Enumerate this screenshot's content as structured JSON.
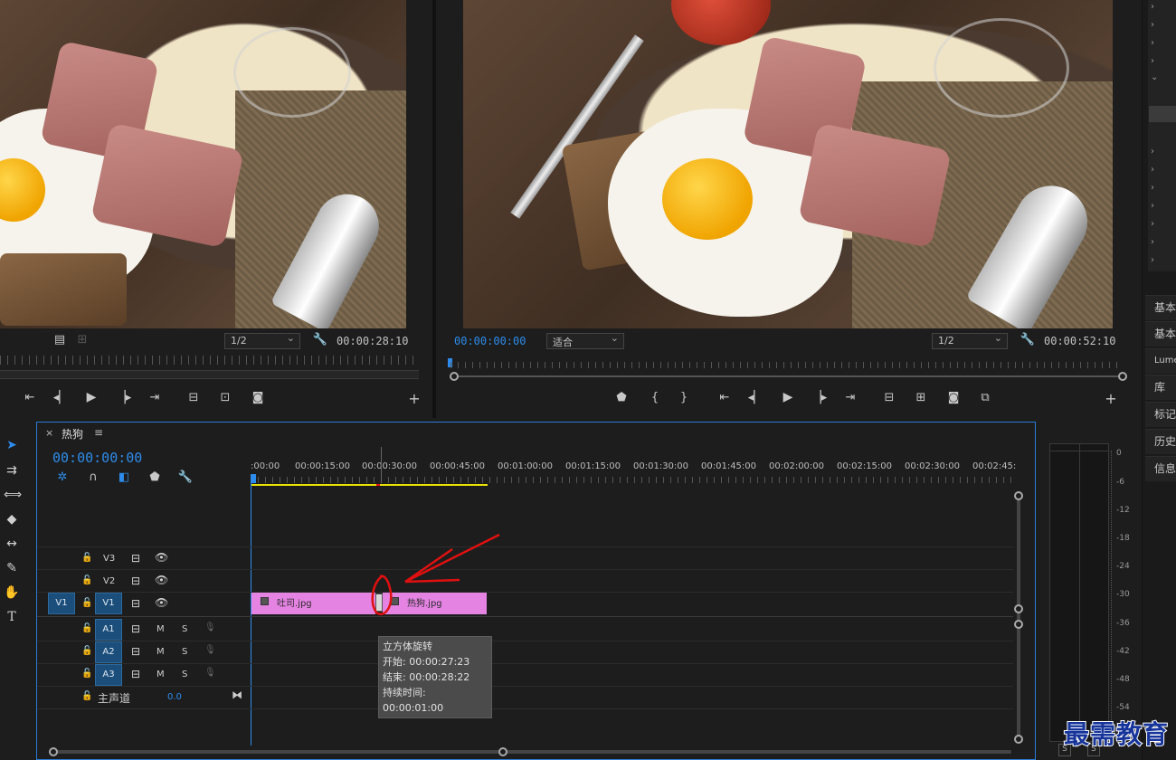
{
  "source_monitor": {
    "zoom": "1/2",
    "timecode": "00:00:28:10"
  },
  "program_monitor": {
    "timecode_current": "00:00:00:00",
    "fit": "适合",
    "zoom": "1/2",
    "timecode_end": "00:00:52:10"
  },
  "timeline": {
    "tab_title": "热狗",
    "close_glyph": "×",
    "menu_glyph": "≡",
    "current_time": "00:00:00:00",
    "ruler_labels": [
      ":00:00",
      "00:00:15:00",
      "00:00:30:00",
      "00:00:45:00",
      "00:01:00:00",
      "00:01:15:00",
      "00:01:30:00",
      "00:01:45:00",
      "00:02:00:00",
      "00:02:15:00",
      "00:02:30:00",
      "00:02:45:"
    ],
    "tracks": {
      "video": [
        "V3",
        "V2",
        "V1"
      ],
      "audio": [
        "A1",
        "A2",
        "A3"
      ],
      "source_target_v": "V1",
      "master_label": "主声道",
      "master_value": "0.0",
      "mute": "M",
      "solo": "S"
    },
    "clips": [
      {
        "name": "吐司.jpg"
      },
      {
        "name": "热狗.jpg"
      }
    ],
    "tooltip": {
      "title": "立方体旋转",
      "start": "开始: 00:00:27:23",
      "end": "结束: 00:00:28:22",
      "duration": "持续时间: 00:00:01:00"
    }
  },
  "right_panel": {
    "items": [
      "基本",
      "基本",
      "Lume",
      "库",
      "标记",
      "历史",
      "信息"
    ]
  },
  "audio_meter": {
    "labels": [
      "0",
      "-6",
      "-12",
      "-18",
      "-24",
      "-30",
      "-36",
      "-42",
      "-48",
      "-54"
    ],
    "solo": [
      "S",
      "S"
    ]
  },
  "watermark": "最需教育",
  "colors": {
    "accent_blue": "#2d8ceb",
    "clip_pink": "#e583e3",
    "annotation_red": "#e01010",
    "work_area_yellow": "#e8e000"
  }
}
